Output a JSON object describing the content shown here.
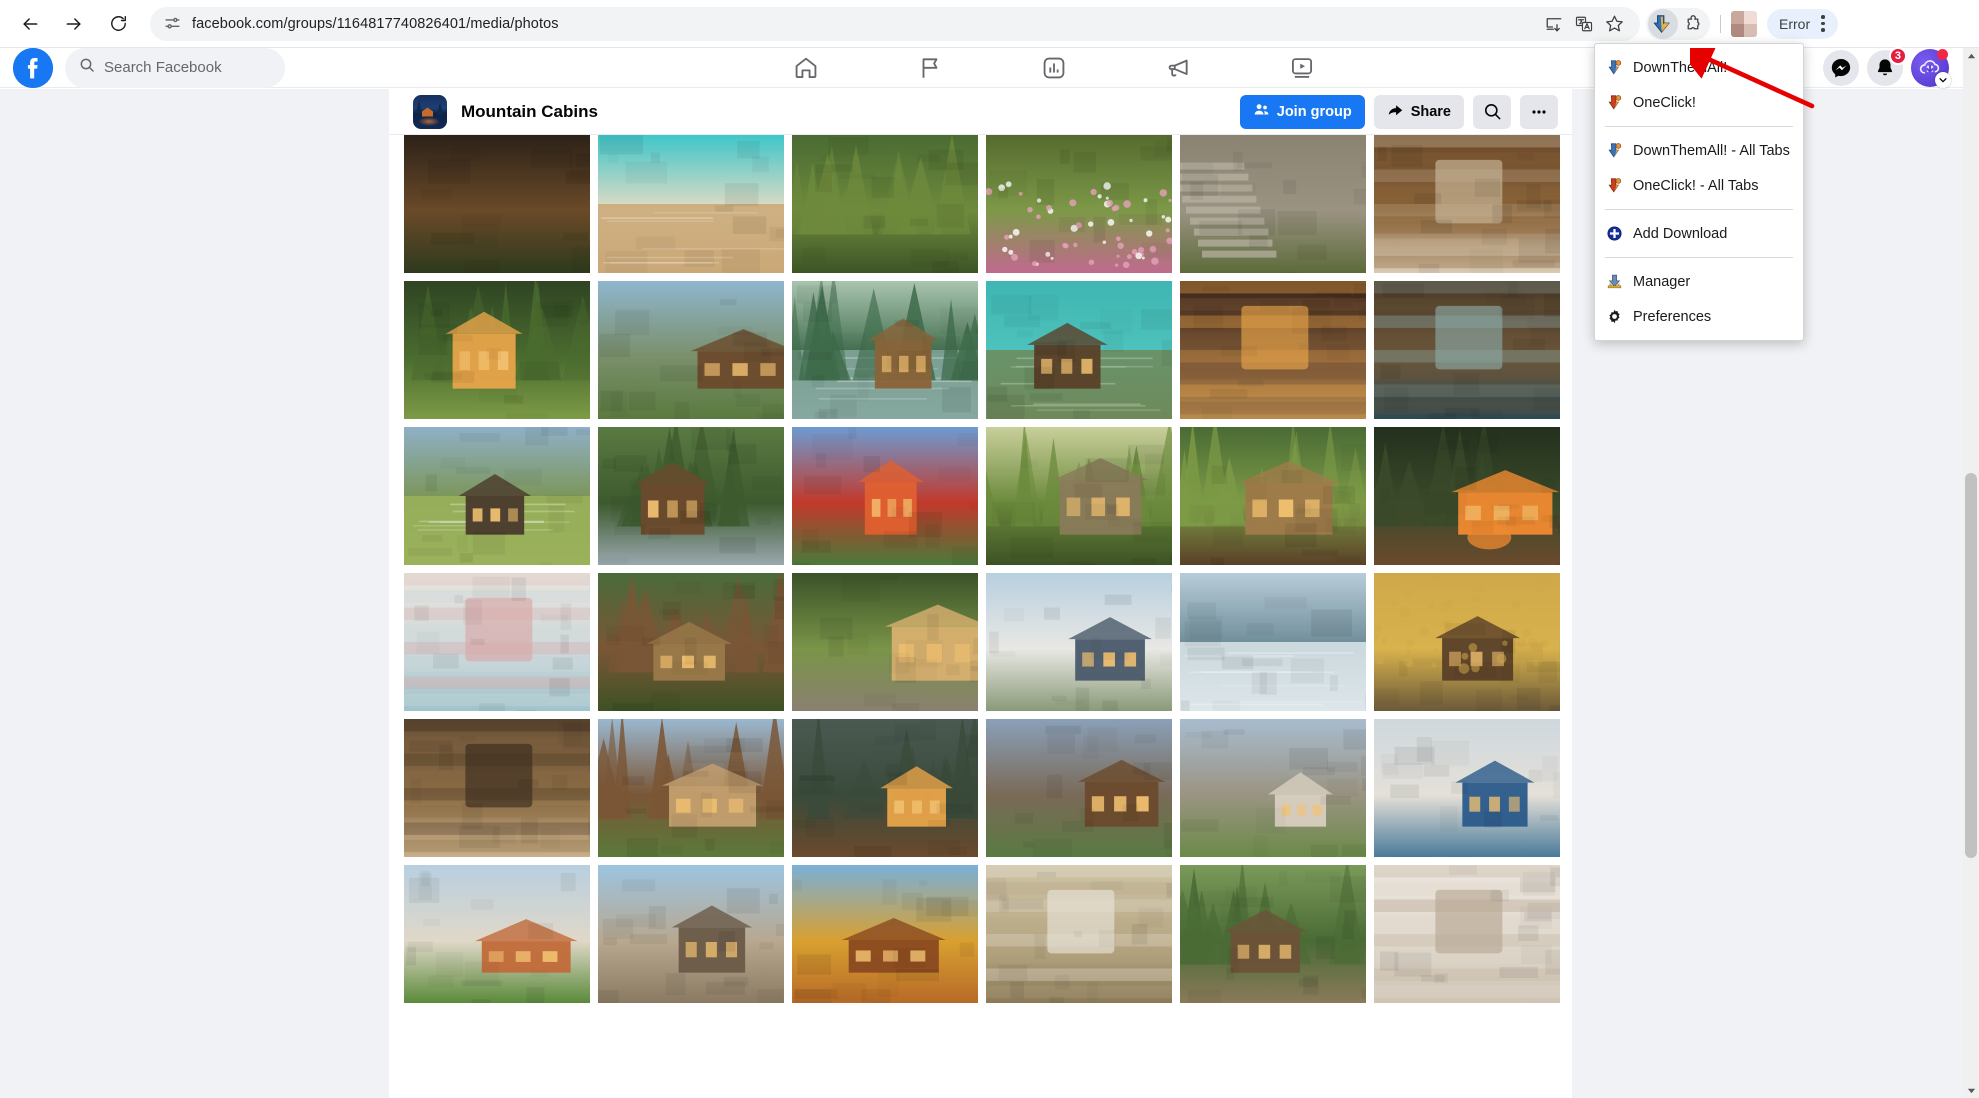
{
  "browser": {
    "back_icon": "back-arrow-icon",
    "forward_icon": "forward-arrow-icon",
    "reload_icon": "reload-icon",
    "site_info_icon": "site-settings-icon",
    "url": "facebook.com/groups/1164817740826401/media/photos",
    "omnibox_actions": [
      "install-app-icon",
      "translate-icon",
      "bookmark-star-icon"
    ],
    "extension_icons": [
      "downthemall-extension-icon",
      "extensions-puzzle-icon"
    ],
    "profile_avatar": "chrome-profile-avatar",
    "error_label": "Error",
    "menu_icon": "chrome-kebab-menu-icon"
  },
  "facebook": {
    "logo": "facebook-logo-icon",
    "search": {
      "placeholder": "Search Facebook",
      "value": "",
      "icon": "search-icon"
    },
    "nav": [
      {
        "name": "home",
        "icon": "home-icon"
      },
      {
        "name": "pages",
        "icon": "flag-icon"
      },
      {
        "name": "marketplace",
        "icon": "marketplace-chart-icon"
      },
      {
        "name": "ads",
        "icon": "megaphone-icon"
      },
      {
        "name": "video",
        "icon": "video-monitor-icon"
      }
    ],
    "right": {
      "messenger_icon": "messenger-icon",
      "notifications_icon": "bell-icon",
      "notifications_count": "3",
      "account_avatar": "account-avatar"
    }
  },
  "group": {
    "thumbnail": "group-thumbnail-night-cabin",
    "name": "Mountain Cabins",
    "join_label": "Join group",
    "join_icon": "group-members-icon",
    "share_label": "Share",
    "share_icon": "share-arrow-icon",
    "search_icon": "search-icon",
    "more_icon": "more-horizontal-icon"
  },
  "dta_menu": {
    "items": [
      {
        "label": "DownThemAll!",
        "icon": "dta-download-arrow-icon",
        "sep_after": false
      },
      {
        "label": "OneClick!",
        "icon": "oneclick-download-arrow-icon",
        "sep_after": true
      },
      {
        "label": "DownThemAll! - All Tabs",
        "icon": "dta-download-arrow-icon",
        "sep_after": false
      },
      {
        "label": "OneClick! - All Tabs",
        "icon": "oneclick-download-arrow-icon",
        "sep_after": true
      },
      {
        "label": "Add Download",
        "icon": "add-download-plus-icon",
        "sep_after": true
      },
      {
        "label": "Manager",
        "icon": "manager-icon",
        "sep_after": false
      },
      {
        "label": "Preferences",
        "icon": "gear-icon",
        "sep_after": false
      }
    ],
    "annotation_arrow": "red-pointer-arrow"
  },
  "colors": {
    "fb_blue": "#1877f2",
    "page_bg": "#f0f2f5",
    "badge_red": "#e41e3f",
    "annotation_red": "#e60000",
    "error_chip_bg": "#e8f0fe"
  },
  "scrollbar": {
    "up_icon": "scroll-up-arrow-icon",
    "down_icon": "scroll-down-arrow-icon"
  },
  "photos": [
    {
      "id": "p1",
      "alt": "cabin porch with plants",
      "sky": "#2c2218",
      "g1": "#6a4a28",
      "g2": "#2e3a1d",
      "accent": "#d08a3c",
      "kind": "porch"
    },
    {
      "id": "p2",
      "alt": "beach chairs by turquoise water",
      "sky": "#3fc6c9",
      "g1": "#e5dcc4",
      "g2": "#caa877",
      "accent": "#8b6a3c",
      "kind": "beach"
    },
    {
      "id": "p3",
      "alt": "fallen log in green forest",
      "sky": "#4a6b33",
      "g1": "#6e8a3c",
      "g2": "#3d5426",
      "accent": "#8a6d42",
      "kind": "forest"
    },
    {
      "id": "p4",
      "alt": "pink wildflower meadow",
      "sky": "#556b2f",
      "g1": "#7d9948",
      "g2": "#c06a8e",
      "accent": "#e8a0bc",
      "kind": "meadow"
    },
    {
      "id": "p5",
      "alt": "stone staircase with rocks",
      "sky": "#8a8372",
      "g1": "#9b9382",
      "g2": "#5d6b3a",
      "accent": "#b7b0a0",
      "kind": "stairs"
    },
    {
      "id": "p6",
      "alt": "wooden cabin interior with sofa",
      "sky": "#6b4a2c",
      "g1": "#8a6338",
      "g2": "#d9cbb4",
      "accent": "#c9b89b",
      "kind": "interior"
    },
    {
      "id": "p7",
      "alt": "log cabin in pine forest at dusk",
      "sky": "#2f4423",
      "g1": "#4a6b2f",
      "g2": "#7d9b46",
      "accent": "#e8a44a",
      "kind": "cabin-forest"
    },
    {
      "id": "p8",
      "alt": "cabin by river under mountains",
      "sky": "#8fb6cf",
      "g1": "#7a8f6a",
      "g2": "#5a7a3f",
      "accent": "#6b4a2c",
      "kind": "cabin-mountain"
    },
    {
      "id": "p9",
      "alt": "small cabin on island in lake",
      "sky": "#a9c4b0",
      "g1": "#3e6b4a",
      "g2": "#86a8a0",
      "accent": "#8a6338",
      "kind": "island"
    },
    {
      "id": "p10",
      "alt": "modern cabin over turquoise water",
      "sky": "#3fb6b2",
      "g1": "#4fc3bd",
      "g2": "#6f8a5a",
      "accent": "#5a4028",
      "kind": "water-cabin"
    },
    {
      "id": "p11",
      "alt": "stone fireplace interior",
      "sky": "#3a2418",
      "g1": "#7a5636",
      "g2": "#b88a4c",
      "accent": "#e8a44a",
      "kind": "fireplace"
    },
    {
      "id": "p12",
      "alt": "hobbit style round window kitchen",
      "sky": "#4a3a28",
      "g1": "#6b563a",
      "g2": "#2f4a52",
      "accent": "#8aa8a4",
      "kind": "round-window"
    },
    {
      "id": "p13",
      "alt": "lakeside cabin with green lawn",
      "sky": "#8fb0c7",
      "g1": "#7a9450",
      "g2": "#9bb25c",
      "accent": "#4a3a2c",
      "kind": "lake-cabin"
    },
    {
      "id": "p14",
      "alt": "wooden lodge by mountain stream",
      "sky": "#5a7a42",
      "g1": "#3d5a2e",
      "g2": "#9aa8ae",
      "accent": "#6b4a2c",
      "kind": "stream-lodge"
    },
    {
      "id": "p15",
      "alt": "red cabin with palm trees",
      "sky": "#6d9bd1",
      "g1": "#c2392b",
      "g2": "#4a7a3a",
      "accent": "#e06030",
      "kind": "red-cabin"
    },
    {
      "id": "p16",
      "alt": "sunlit cabin in woods",
      "sky": "#c9cf9a",
      "g1": "#6b8a3c",
      "g2": "#3d5224",
      "accent": "#8a7a5a",
      "kind": "sunlit"
    },
    {
      "id": "p17",
      "alt": "log cabin with porch in clearing",
      "sky": "#4a6b35",
      "g1": "#7d9b46",
      "g2": "#5a4028",
      "accent": "#a07a4a",
      "kind": "clearing"
    },
    {
      "id": "p18",
      "alt": "cabin at night with campfire",
      "sky": "#23301d",
      "g1": "#3a4a2a",
      "g2": "#6b4a2c",
      "accent": "#f08a30",
      "kind": "campfire"
    },
    {
      "id": "p19",
      "alt": "white coastal cottage interior",
      "sky": "#e8e4dc",
      "g1": "#cfd9db",
      "g2": "#9ec4cc",
      "accent": "#d8a8a8",
      "kind": "coastal"
    },
    {
      "id": "p20",
      "alt": "rustic log cabin among trees",
      "sky": "#4a6b3a",
      "g1": "#7a5636",
      "g2": "#3d5224",
      "accent": "#9a7a4a",
      "kind": "rustic"
    },
    {
      "id": "p21",
      "alt": "stone cottage with stepping stones",
      "sky": "#3a5228",
      "g1": "#7a9448",
      "g2": "#8a8070",
      "accent": "#d8b070",
      "kind": "stone-cottage"
    },
    {
      "id": "p22",
      "alt": "white cottage with slate roof",
      "sky": "#b8cfe0",
      "g1": "#e8e8e4",
      "g2": "#8a9a78",
      "accent": "#4a5a6a",
      "kind": "white-cottage"
    },
    {
      "id": "p23",
      "alt": "snowy lake with evergreen forest",
      "sky": "#b8ccd8",
      "g1": "#6a8a96",
      "g2": "#dde6ea",
      "accent": "#3a5a4a",
      "kind": "snow"
    },
    {
      "id": "p24",
      "alt": "autumn barn with horses",
      "sky": "#cfa84a",
      "g1": "#d8b24c",
      "g2": "#6b5a3a",
      "accent": "#5a4028",
      "kind": "autumn"
    },
    {
      "id": "p25",
      "alt": "cabin kitchen with wood cabinets",
      "sky": "#6b5238",
      "g1": "#8a6b44",
      "g2": "#c9b08a",
      "accent": "#3a2c1e",
      "kind": "kitchen"
    },
    {
      "id": "p26",
      "alt": "two story cabin with stairs",
      "sky": "#9ab8cf",
      "g1": "#7a5636",
      "g2": "#5a7a3a",
      "accent": "#c4a070",
      "kind": "two-story"
    },
    {
      "id": "p27",
      "alt": "lit cabin at twilight in forest",
      "sky": "#4a5a52",
      "g1": "#3a4a3a",
      "g2": "#6b4a2c",
      "accent": "#e8a44a",
      "kind": "twilight"
    },
    {
      "id": "p28",
      "alt": "mountain cabin on rocky cliff",
      "sky": "#8aa0b8",
      "g1": "#7a6a58",
      "g2": "#5a7a42",
      "accent": "#6b4a2c",
      "kind": "cliff"
    },
    {
      "id": "p29",
      "alt": "stone cottage with patio table",
      "sky": "#a8bccf",
      "g1": "#9a9482",
      "g2": "#6b8a48",
      "accent": "#d8cfc0",
      "kind": "patio"
    },
    {
      "id": "p30",
      "alt": "white mediterranean house with blue door",
      "sky": "#cfd8de",
      "g1": "#e4e0d8",
      "g2": "#4a7a9a",
      "accent": "#2a5a8a",
      "kind": "mediterranean"
    },
    {
      "id": "p31",
      "alt": "cottage with terracotta roof and trees",
      "sky": "#b8cfe0",
      "g1": "#e0d8c8",
      "g2": "#5a8a3a",
      "accent": "#c26a3a",
      "kind": "terracotta"
    },
    {
      "id": "p32",
      "alt": "stone house under blue sky",
      "sky": "#9cc4e0",
      "g1": "#b8a890",
      "g2": "#8a7a62",
      "accent": "#6a5a48",
      "kind": "stone-house"
    },
    {
      "id": "p33",
      "alt": "a-frame cabin in autumn foliage",
      "sky": "#7ab0d8",
      "g1": "#d8a030",
      "g2": "#b86a28",
      "accent": "#8a4a20",
      "kind": "a-frame"
    },
    {
      "id": "p34",
      "alt": "timber frame interior with window",
      "sky": "#cfc4a8",
      "g1": "#b8a884",
      "g2": "#8a7a58",
      "accent": "#e8e4d8",
      "kind": "timber"
    },
    {
      "id": "p35",
      "alt": "cabin roof among green trees",
      "sky": "#7a9a5a",
      "g1": "#4a6b35",
      "g2": "#8a7a5a",
      "accent": "#6b5238",
      "kind": "roof-trees"
    },
    {
      "id": "p36",
      "alt": "white bedroom with wood ceiling",
      "sky": "#ece6de",
      "g1": "#e0d8cc",
      "g2": "#cfc4b4",
      "accent": "#b8a894",
      "kind": "bedroom"
    }
  ]
}
